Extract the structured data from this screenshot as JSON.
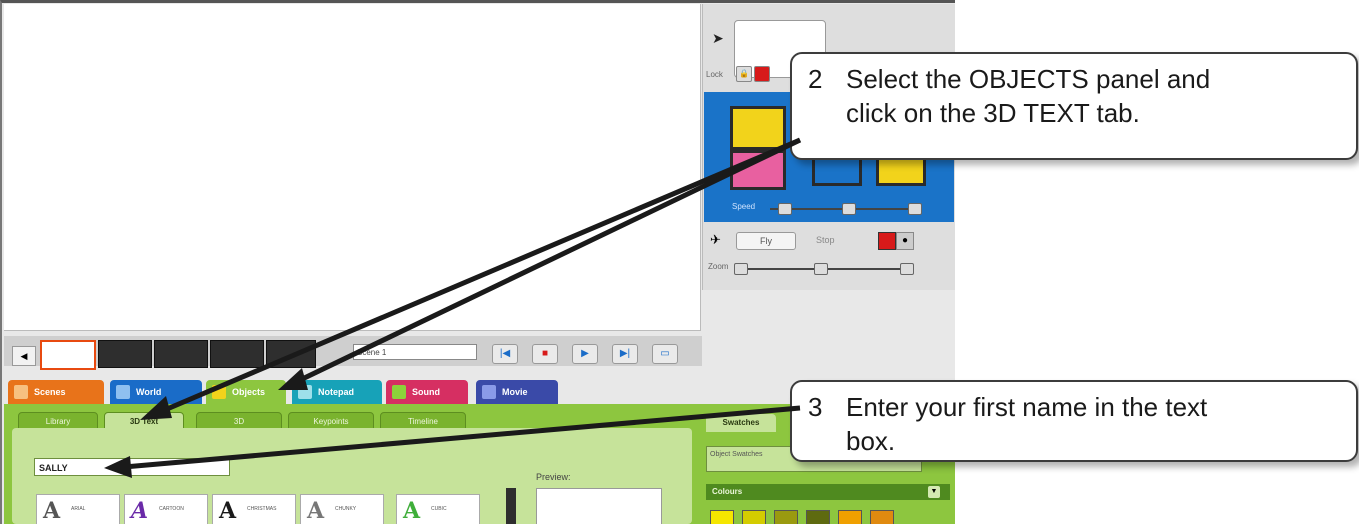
{
  "control_panel": {
    "lock_label": "Lock",
    "speed_label": "Speed",
    "fly_label": "Fly",
    "stop_label": "Stop",
    "zoom_label": "Zoom"
  },
  "timeline": {
    "scene_name": "Scene 1"
  },
  "panel_tabs": [
    "Scenes",
    "World",
    "Objects",
    "Notepad",
    "Sound",
    "Movie"
  ],
  "object_subtabs": [
    "Library",
    "3D Text",
    "3D",
    "Keypoints",
    "Timeline"
  ],
  "text_tab": {
    "name_value": "SALLY",
    "preview_label": "Preview:",
    "fonts": [
      {
        "glyph": "A",
        "name": "ARIAL"
      },
      {
        "glyph": "A",
        "name": "CARTOON"
      },
      {
        "glyph": "A",
        "name": "CHRISTMAS"
      },
      {
        "glyph": "A",
        "name": "CHUNKY"
      },
      {
        "glyph": "A",
        "name": "CUBIC"
      }
    ]
  },
  "swatches_panel": {
    "tab_label": "Swatches",
    "box_text": "Object Swatches",
    "colours_label": "Colours",
    "colours": [
      "#f5e600",
      "#d4cc00",
      "#9a9a10",
      "#5e6a10",
      "#f0a000",
      "#e08a10"
    ]
  },
  "tab_colors": {
    "Scenes": "#e8731a",
    "World": "#1a6cc8",
    "Objects": "#8dc63f",
    "Notepad": "#17a2b8",
    "Sound": "#d62f62",
    "Movie": "#3a4aa8"
  },
  "callouts": [
    {
      "number": "2",
      "text": "Select the OBJECTS panel and\nclick on the 3D TEXT tab."
    },
    {
      "number": "3",
      "text": "Enter your first name in the text\nbox."
    }
  ]
}
